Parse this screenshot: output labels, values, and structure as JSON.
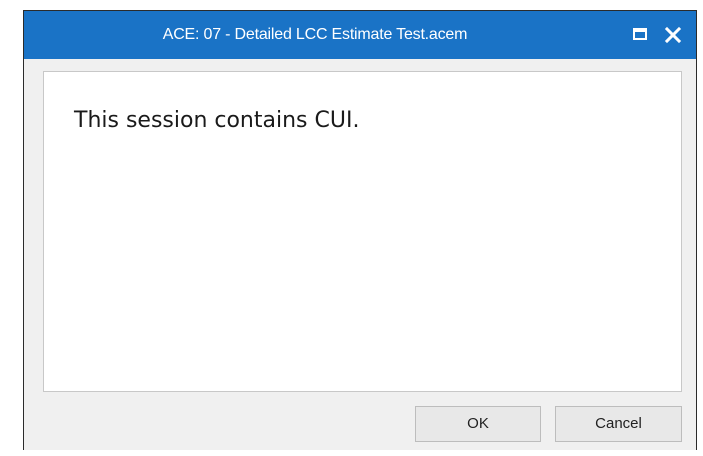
{
  "window": {
    "title": "ACE: 07 - Detailed LCC Estimate Test.acem",
    "titlebar_color": "#1a73c6"
  },
  "titlebar_controls": {
    "maximize_icon": "maximize-icon",
    "close_icon": "close-icon"
  },
  "body": {
    "message": "This session contains CUI."
  },
  "buttons": {
    "ok_label": "OK",
    "cancel_label": "Cancel"
  }
}
